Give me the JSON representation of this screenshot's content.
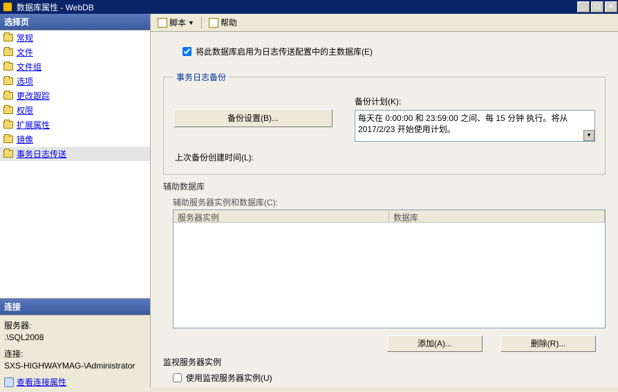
{
  "window": {
    "title": "数据库属性 - WebDB"
  },
  "sidebar": {
    "header": "选择页",
    "items": [
      {
        "label": "常规"
      },
      {
        "label": "文件"
      },
      {
        "label": "文件组"
      },
      {
        "label": "选项"
      },
      {
        "label": "更改跟踪"
      },
      {
        "label": "权限"
      },
      {
        "label": "扩展属性"
      },
      {
        "label": "镜像"
      },
      {
        "label": "事务日志传送"
      }
    ],
    "conn_header": "连接",
    "server_label": "服务器:",
    "server_value": ".\\SQL2008",
    "conn_label": "连接:",
    "conn_value": "SXS-HIGHWAYMAG-\\Administrator",
    "conn_link": "查看连接属性"
  },
  "toolbar": {
    "script": "脚本",
    "help": "帮助"
  },
  "main": {
    "primary_checkbox": "将此数据库启用为日志传送配置中的主数据库(E)",
    "backup_group": "事务日志备份",
    "backup_settings_btn": "备份设置(B)...",
    "plan_label": "备份计划(K):",
    "plan_text": "每天在 0:00:00 和 23:59:00 之间、每 15 分钟 执行。将从 2017/2/23 开始使用计划。",
    "last_backup_label": "上次备份创建时间(L):",
    "secondary_group": "辅助数据库",
    "sec_instances_label": "辅助服务器实例和数据库(C):",
    "col_server": "服务器实例",
    "col_db": "数据库",
    "add_btn": "添加(A)...",
    "remove_btn": "删除(R)...",
    "monitor_label": "监视服务器实例",
    "monitor_checkbox": "使用监视服务器实例(U)"
  }
}
